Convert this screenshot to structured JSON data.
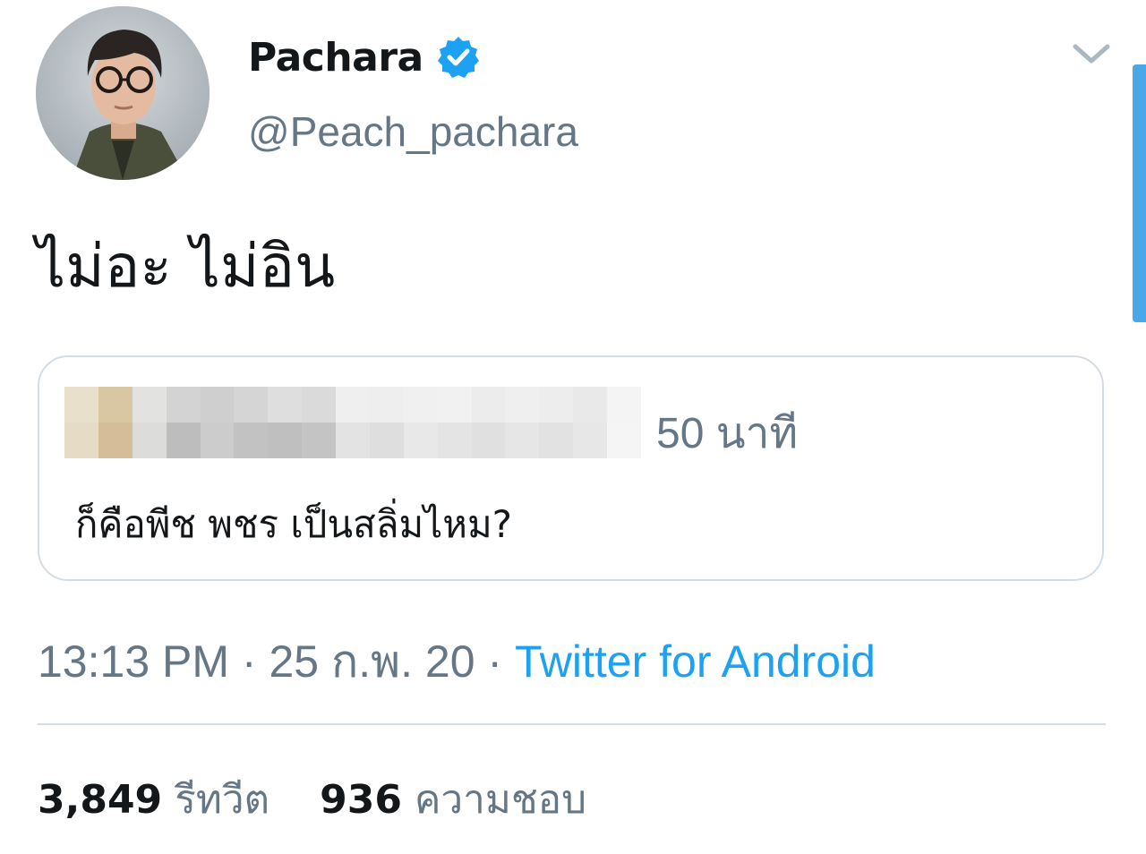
{
  "author": {
    "display_name": "Pachara",
    "handle": "@Peach_pachara",
    "verified": true,
    "avatar_icon": "profile-photo"
  },
  "tweet": {
    "text": "ไม่อะ ไม่อิน"
  },
  "quoted_tweet": {
    "time": "50 นาที",
    "text": "ก็คือพีช พชร เป็นสลิ่มไหม?",
    "author_blurred": true
  },
  "meta": {
    "time": "13:13 PM",
    "separator": "·",
    "date": "25 ก.พ. 20",
    "source": "Twitter for Android"
  },
  "stats": {
    "retweets_count": "3,849",
    "retweets_label": "รีทวีต",
    "likes_count": "936",
    "likes_label": "ความชอบ"
  },
  "colors": {
    "text_primary": "#14171a",
    "text_secondary": "#657786",
    "accent": "#1da1f2",
    "border": "#d4dde3",
    "verified": "#1da1f2"
  }
}
